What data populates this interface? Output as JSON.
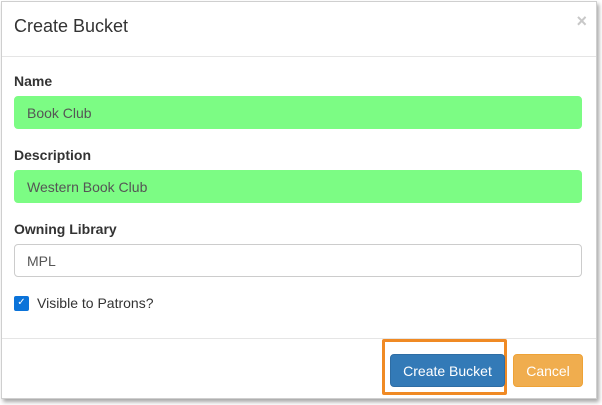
{
  "modal": {
    "title": "Create Bucket",
    "close_symbol": "×"
  },
  "form": {
    "name_label": "Name",
    "name_value": "Book Club",
    "description_label": "Description",
    "description_value": "Western Book Club",
    "library_label": "Owning Library",
    "library_value": "MPL",
    "visible_label": "Visible to Patrons?",
    "visible_checked": true
  },
  "buttons": {
    "create_label": "Create Bucket",
    "cancel_label": "Cancel"
  },
  "colors": {
    "filled_field": "#7cfc84",
    "primary": "#337ab7",
    "warning": "#f0ad4e",
    "highlight": "#f08a24",
    "checkbox": "#0b73d9"
  },
  "icons": {
    "close": "close-icon",
    "check": "checkmark-icon"
  }
}
